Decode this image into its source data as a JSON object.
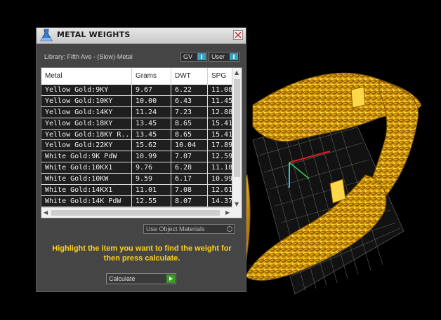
{
  "window": {
    "title": "METAL WEIGHTS"
  },
  "library_label": "Library: Fifth Ave - (Slow)-Metal",
  "toggles": {
    "gv": "GV",
    "user": "User"
  },
  "table": {
    "headers": [
      "Metal",
      "Grams",
      "DWT",
      "SPG"
    ],
    "rows": [
      [
        "Yellow Gold:9KY",
        "9.67",
        "6.22",
        "11.08"
      ],
      [
        "Yellow Gold:10KY",
        "10.00",
        "6.43",
        "11.45"
      ],
      [
        "Yellow Gold:14KY",
        "11.24",
        "7.23",
        "12.88"
      ],
      [
        "Yellow Gold:18KY",
        "13.45",
        "8.65",
        "15.41"
      ],
      [
        "Yellow Gold:18KY R...",
        "13.45",
        "8.65",
        "15.41"
      ],
      [
        "Yellow Gold:22KY",
        "15.62",
        "10.04",
        "17.89"
      ],
      [
        "White Gold:9K PdW",
        "10.99",
        "7.07",
        "12.59"
      ],
      [
        "White Gold:10KX1",
        "9.76",
        "6.28",
        "11.18"
      ],
      [
        "White Gold:10KW",
        "9.59",
        "6.17",
        "10.99"
      ],
      [
        "White Gold:14KX1",
        "11.01",
        "7.08",
        "12.61"
      ],
      [
        "White Gold:14K PdW",
        "12.55",
        "8.07",
        "14.37"
      ]
    ]
  },
  "use_object_materials": "Use Object Materials",
  "hint_text": "Highlight the item you want to find the weight for then press calculate.",
  "calculate_label": "Calculate",
  "colors": {
    "accent_yellow": "#ffd21a",
    "toggle_blue": "#3aa0c0",
    "go_green": "#3c9a28",
    "panel_bg": "#454545"
  },
  "icons": {
    "title": "metal-weights-flask-icon",
    "close": "close-icon"
  }
}
